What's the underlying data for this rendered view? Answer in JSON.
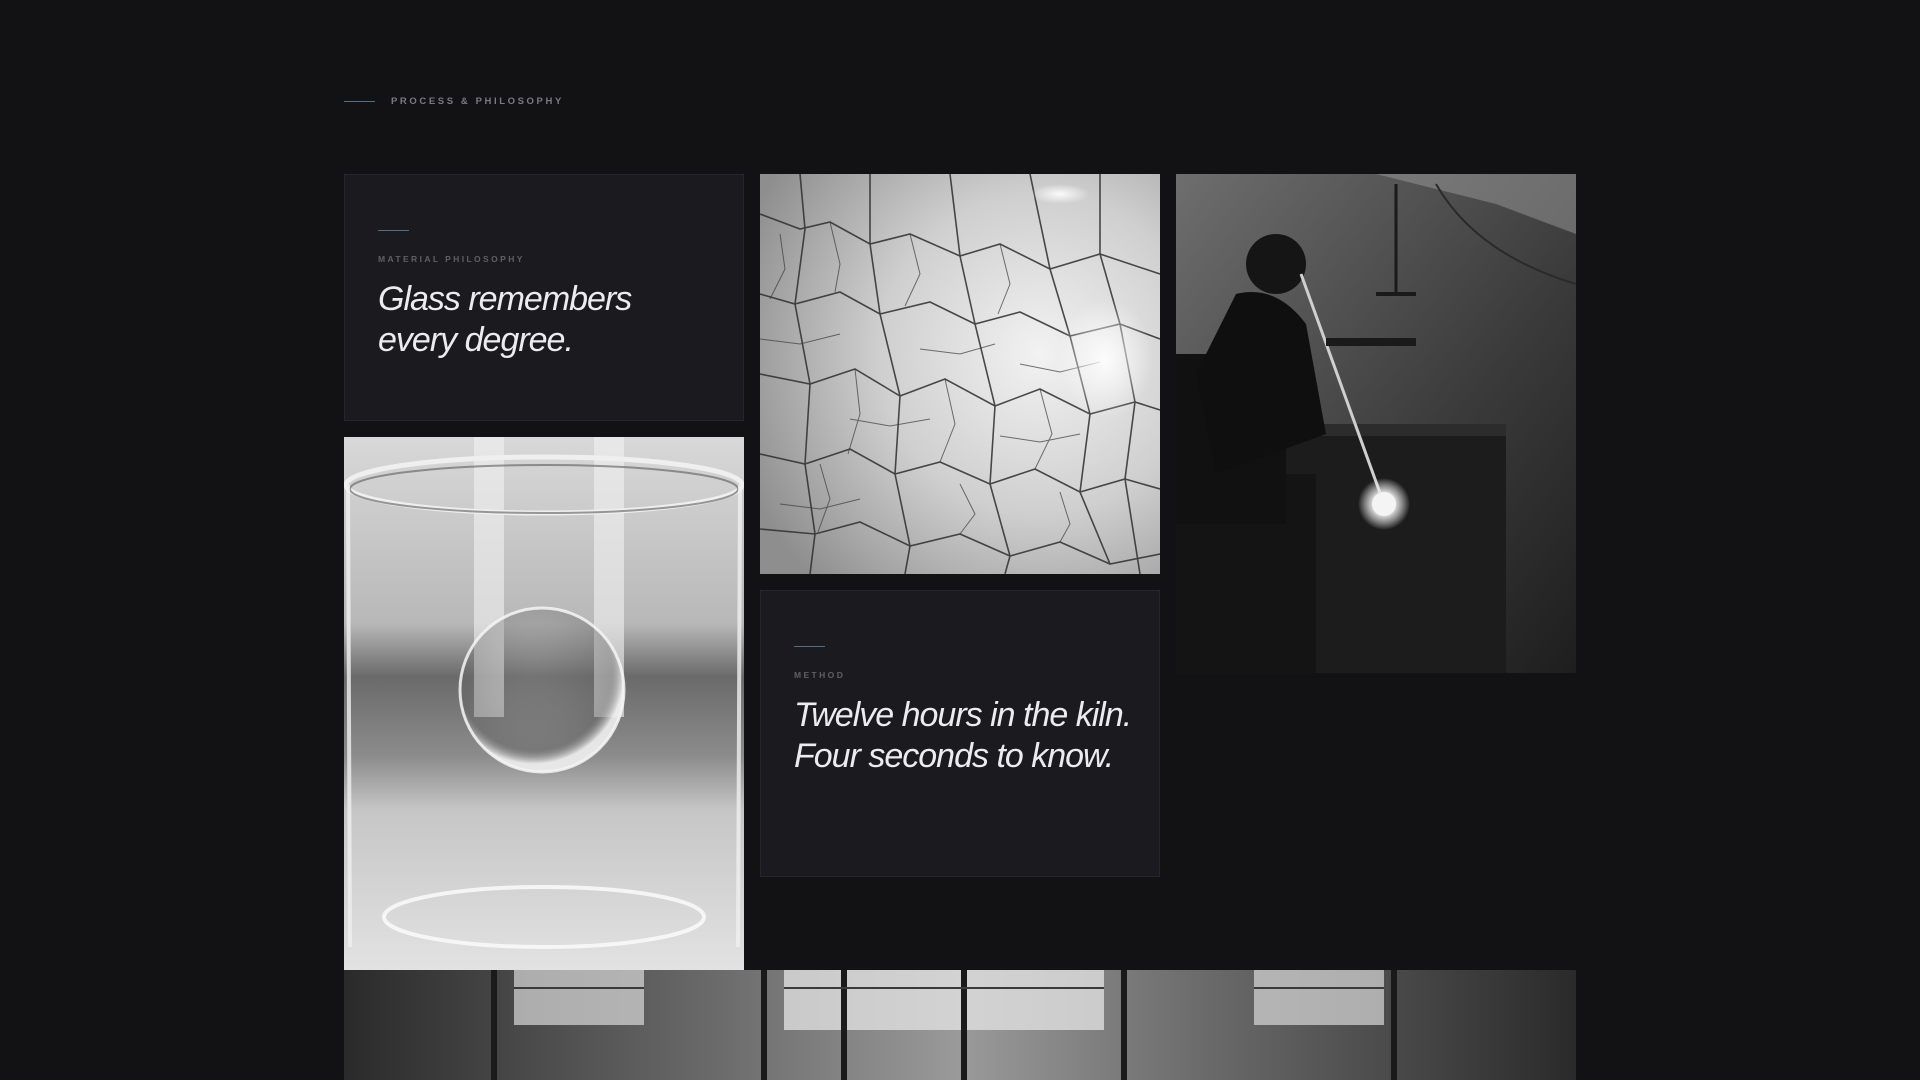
{
  "section": {
    "label": "PROCESS & PHILOSOPHY",
    "accent_color": "#4f6c93"
  },
  "cards": [
    {
      "label": "MATERIAL PHILOSOPHY",
      "quote": "Glass remembers every degree."
    },
    {
      "label": "METHOD",
      "quote": "Twelve hours in the kiln. Four seconds to know."
    }
  ],
  "photos": {
    "crackle": "crackle-glaze-texture-photo",
    "glass": "glass-with-bubble-photo",
    "glassblower": "glassblower-at-furnace-photo",
    "studio": "studio-interior-windows-photo"
  },
  "colors": {
    "background": "#121215",
    "card": "#1b1b1f",
    "text": "#ececee",
    "muted": "#7a7a80"
  }
}
